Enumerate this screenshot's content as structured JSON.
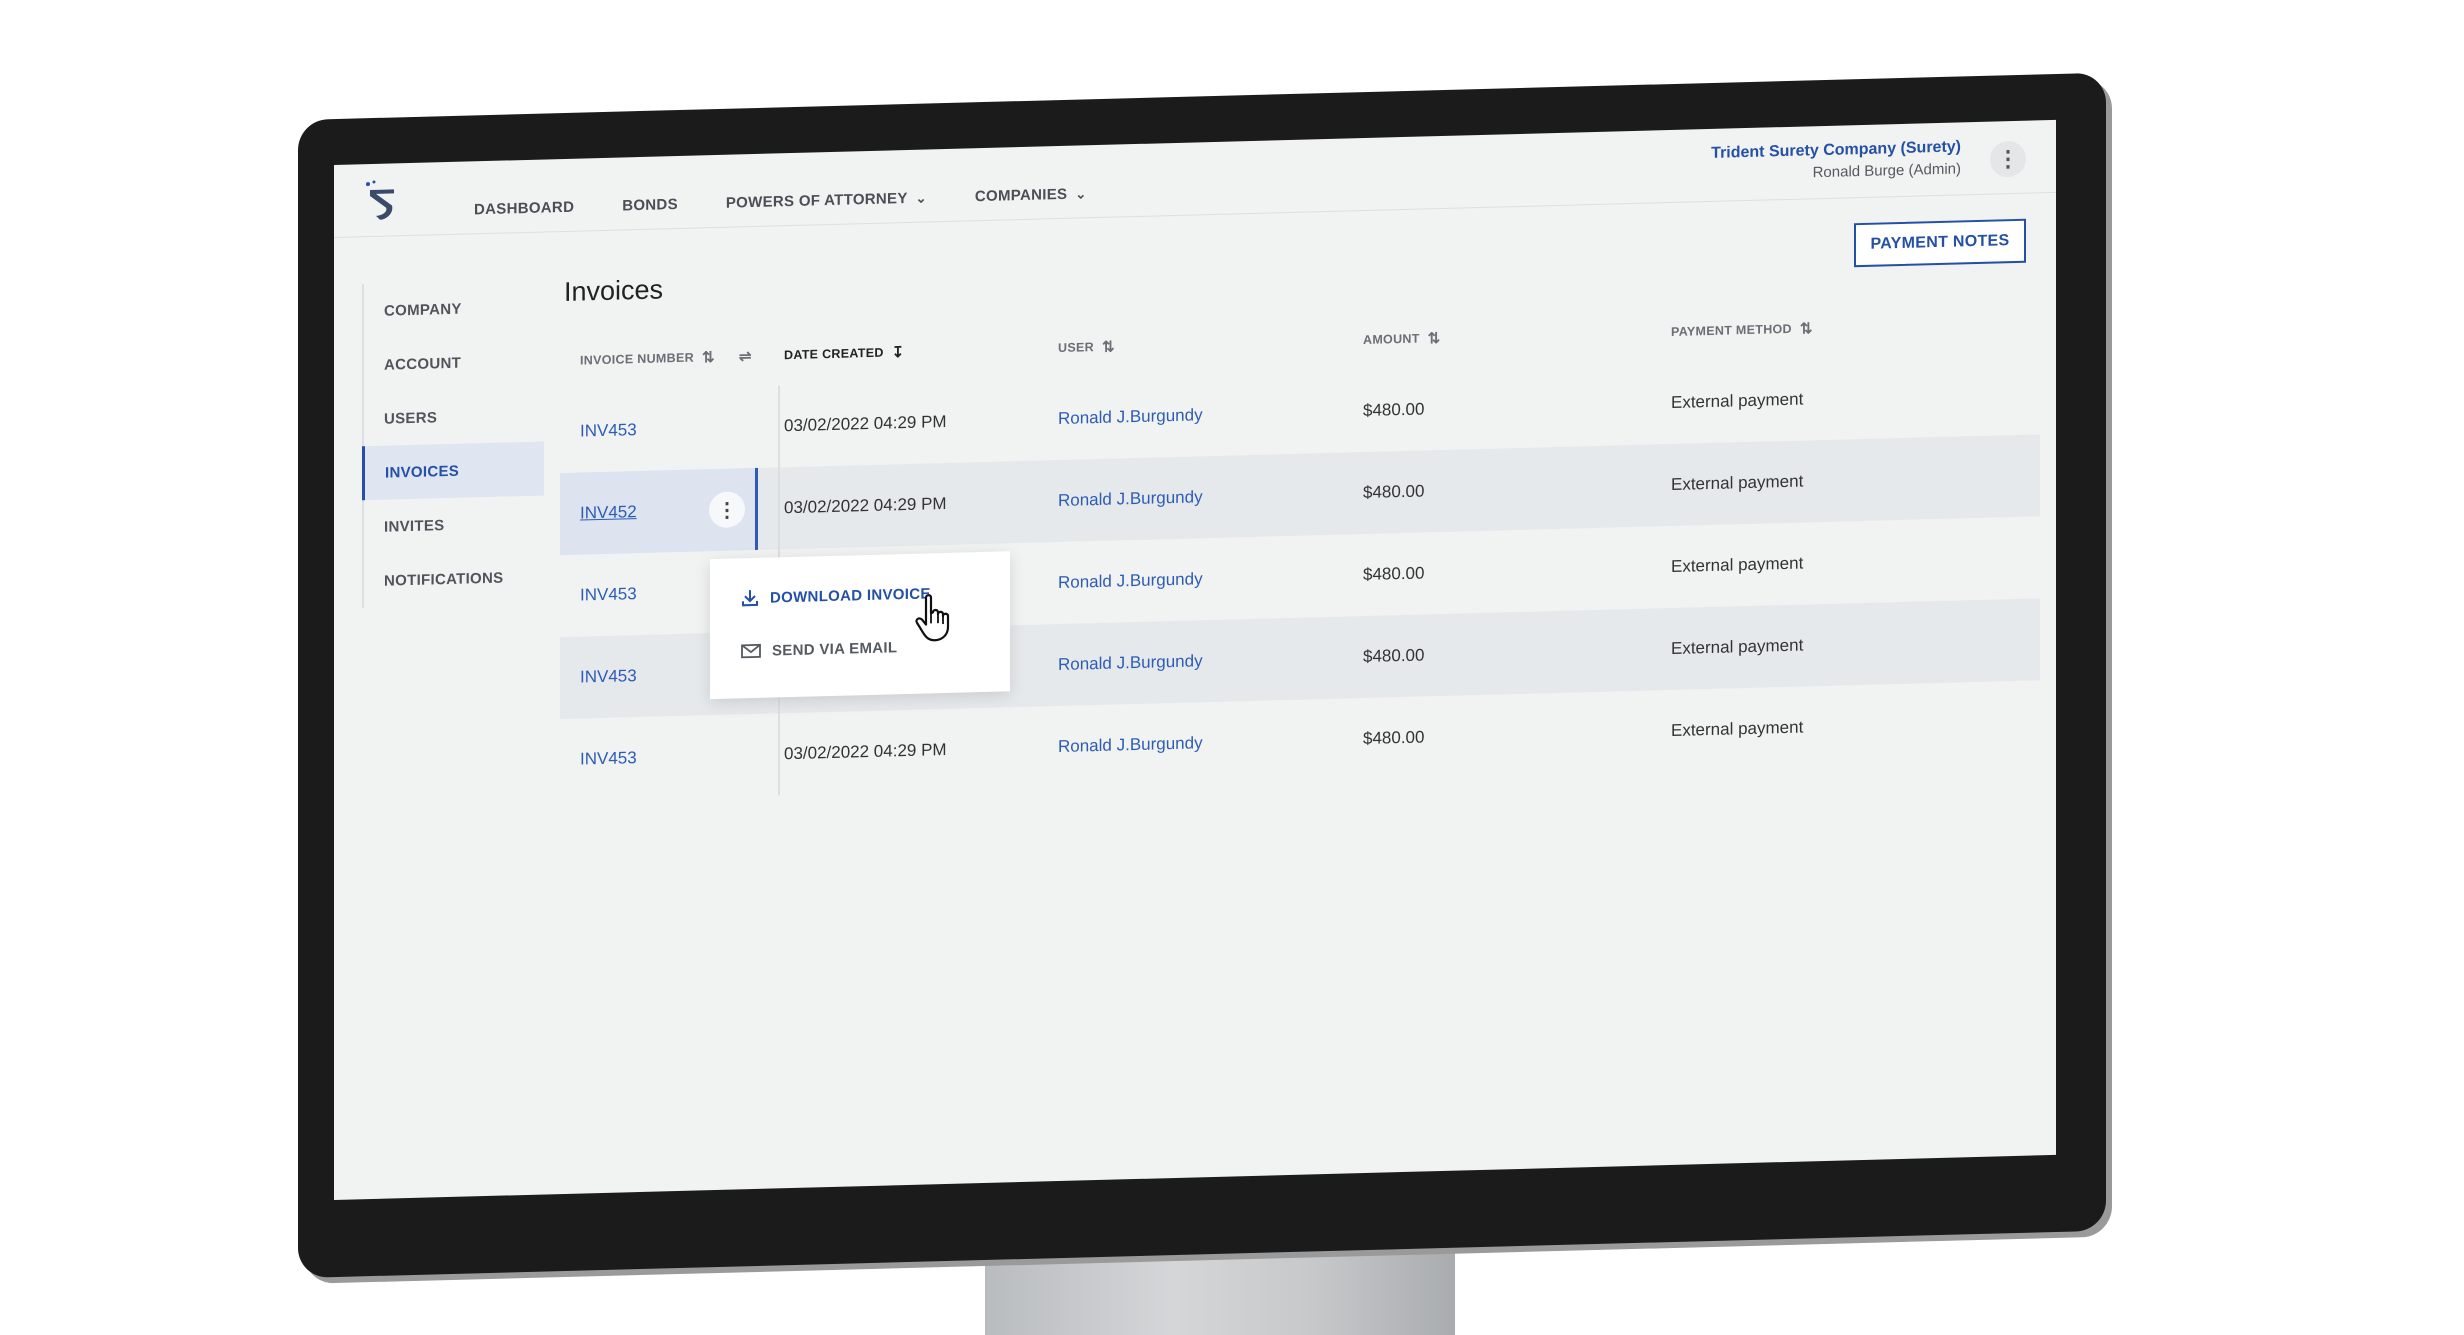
{
  "header": {
    "nav": [
      {
        "label": "DASHBOARD",
        "has_dropdown": false
      },
      {
        "label": "BONDS",
        "has_dropdown": false
      },
      {
        "label": "POWERS OF ATTORNEY",
        "has_dropdown": true
      },
      {
        "label": "COMPANIES",
        "has_dropdown": true
      }
    ],
    "org_name": "Trident Surety Company (Surety)",
    "user_name": "Ronald Burge (Admin)"
  },
  "sidebar": {
    "items": [
      {
        "label": "COMPANY"
      },
      {
        "label": "ACCOUNT"
      },
      {
        "label": "USERS"
      },
      {
        "label": "INVOICES",
        "active": true
      },
      {
        "label": "INVITES"
      },
      {
        "label": "NOTIFICATIONS"
      }
    ]
  },
  "main": {
    "title": "Invoices",
    "payment_notes_label": "PAYMENT NOTES",
    "columns": [
      "INVOICE NUMBER",
      "DATE CREATED",
      "USER",
      "AMOUNT",
      "PAYMENT METHOD"
    ],
    "rows": [
      {
        "invoice": "INV453",
        "date": "03/02/2022 04:29 PM",
        "user": "Ronald J.Burgundy",
        "amount": "$480.00",
        "method": "External payment"
      },
      {
        "invoice": "INV452",
        "date": "03/02/2022 04:29 PM",
        "user": "Ronald J.Burgundy",
        "amount": "$480.00",
        "method": "External payment"
      },
      {
        "invoice": "INV453",
        "date": "",
        "user": "Ronald J.Burgundy",
        "amount": "$480.00",
        "method": "External payment"
      },
      {
        "invoice": "INV453",
        "date": "",
        "user": "Ronald J.Burgundy",
        "amount": "$480.00",
        "method": "External payment"
      },
      {
        "invoice": "INV453",
        "date": "03/02/2022 04:29 PM",
        "user": "Ronald J.Burgundy",
        "amount": "$480.00",
        "method": "External payment"
      }
    ]
  },
  "menu": {
    "download_label": "DOWNLOAD INVOICE",
    "email_label": "SEND VIA EMAIL"
  },
  "colors": {
    "accent": "#2450a6",
    "screen_bg": "#f1f2f2",
    "bezel": "#1b1b1b"
  }
}
